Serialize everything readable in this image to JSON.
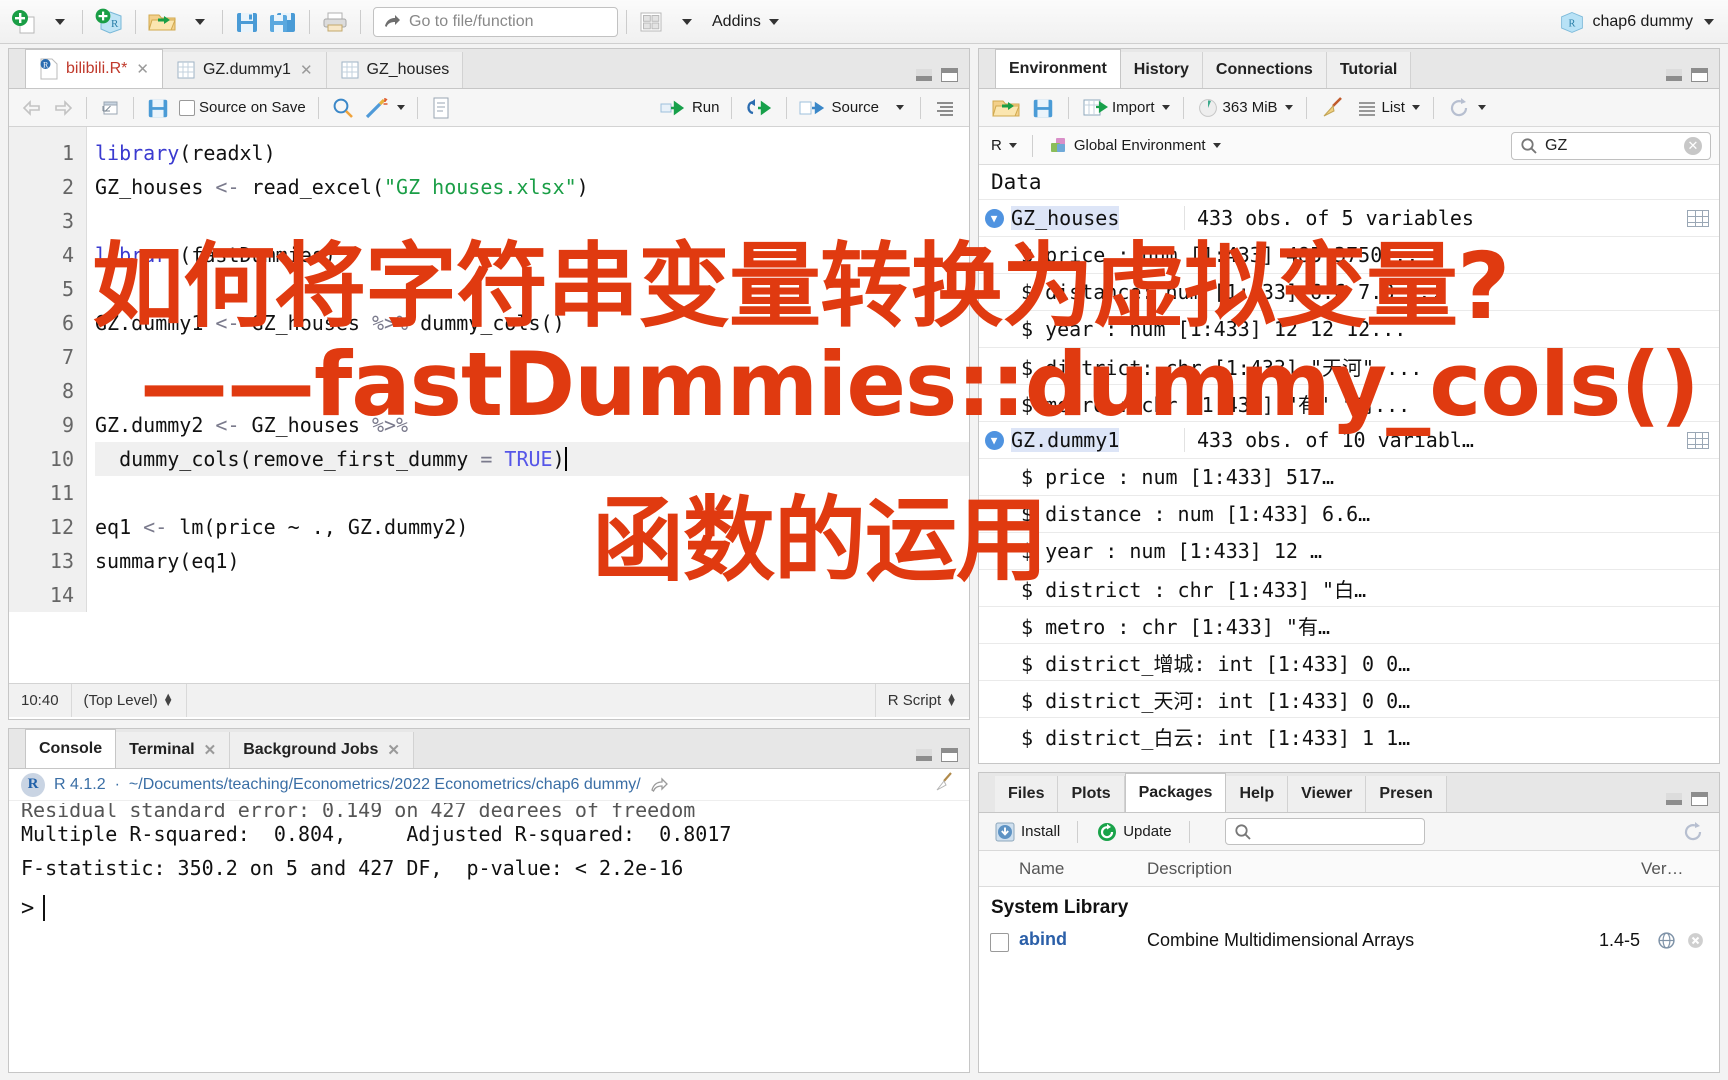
{
  "toolbar": {
    "goto_placeholder": "Go to file/function",
    "addins_label": "Addins",
    "project_name": "chap6 dummy",
    "icons": [
      "new-file-icon",
      "new-project-icon",
      "open-file-icon",
      "save-icon",
      "save-all-icon",
      "print-icon",
      "grid-layout-icon"
    ]
  },
  "source_pane": {
    "tabs": [
      {
        "label": "bilibili.R*",
        "icon": "r-script-icon",
        "closable": true,
        "active": true
      },
      {
        "label": "GZ.dummy1",
        "icon": "data-grid-icon",
        "closable": true,
        "active": false
      },
      {
        "label": "GZ_houses",
        "icon": "data-grid-icon",
        "closable": true,
        "active": false
      }
    ],
    "toolbar": {
      "back_label": "←",
      "forward_label": "→",
      "popout_label": "Show in new window",
      "save_label": "Save",
      "source_on_save_label": "Source on Save",
      "find_label": "Find/Replace",
      "magic_label": "Code Tools",
      "compile_label": "Compile Report",
      "run_label": "Run",
      "rerun_label": "Re-run",
      "source_label": "Source",
      "outline_label": "Document Outline"
    },
    "line_numbers": [
      "1",
      "2",
      "3",
      "4",
      "5",
      "6",
      "7",
      "8",
      "9",
      "10",
      "11",
      "12",
      "13",
      "14"
    ],
    "code": [
      {
        "n": 1,
        "tokens": [
          {
            "t": "library",
            "c": "fn"
          },
          {
            "t": "(readxl)",
            "c": ""
          }
        ]
      },
      {
        "n": 2,
        "tokens": [
          {
            "t": "GZ_houses ",
            "c": ""
          },
          {
            "t": "<-",
            "c": "op"
          },
          {
            "t": " read_excel(",
            "c": ""
          },
          {
            "t": "\"GZ houses.xlsx\"",
            "c": "str"
          },
          {
            "t": ")",
            "c": ""
          }
        ]
      },
      {
        "n": 3,
        "tokens": []
      },
      {
        "n": 4,
        "tokens": [
          {
            "t": "library",
            "c": "fn"
          },
          {
            "t": "(fastDummies)",
            "c": ""
          }
        ]
      },
      {
        "n": 5,
        "tokens": []
      },
      {
        "n": 6,
        "tokens": [
          {
            "t": "GZ.dummy1 ",
            "c": ""
          },
          {
            "t": "<-",
            "c": "op"
          },
          {
            "t": " GZ_houses ",
            "c": ""
          },
          {
            "t": "%>%",
            "c": "op"
          },
          {
            "t": " dummy_cols()",
            "c": ""
          }
        ]
      },
      {
        "n": 7,
        "tokens": []
      },
      {
        "n": 8,
        "tokens": []
      },
      {
        "n": 9,
        "tokens": [
          {
            "t": "GZ.dummy2 ",
            "c": ""
          },
          {
            "t": "<-",
            "c": "op"
          },
          {
            "t": " GZ_houses ",
            "c": ""
          },
          {
            "t": "%>%",
            "c": "op"
          }
        ]
      },
      {
        "n": 10,
        "tokens": [
          {
            "t": "  dummy_cols(remove_first_dummy ",
            "c": ""
          },
          {
            "t": "=",
            "c": "op"
          },
          {
            "t": " ",
            "c": ""
          },
          {
            "t": "TRUE",
            "c": "const"
          },
          {
            "t": ")",
            "c": ""
          }
        ],
        "highlight": true,
        "cursor": true
      },
      {
        "n": 11,
        "tokens": []
      },
      {
        "n": 12,
        "tokens": [
          {
            "t": "eq1 ",
            "c": ""
          },
          {
            "t": "<-",
            "c": "op"
          },
          {
            "t": " lm(price ~ ., GZ.dummy2)",
            "c": ""
          }
        ]
      },
      {
        "n": 13,
        "tokens": [
          {
            "t": "summary(eq1)",
            "c": ""
          }
        ]
      },
      {
        "n": 14,
        "tokens": []
      }
    ],
    "status": {
      "position": "10:40",
      "scope": "(Top Level)",
      "file_type": "R Script"
    }
  },
  "console_pane": {
    "tabs": [
      {
        "label": "Console",
        "closable": false,
        "active": true
      },
      {
        "label": "Terminal",
        "closable": true,
        "active": false
      },
      {
        "label": "Background Jobs",
        "closable": true,
        "active": false
      }
    ],
    "r_version": "R 4.1.2",
    "separator": "·",
    "working_dir": "~/Documents/teaching/Econometrics/2022 Econometrics/chap6 dummy/",
    "output": [
      "Residual standard error: 0.149 on 427 degrees of freedom",
      "Multiple R-squared:  0.804,\tAdjusted R-squared:  0.8017",
      "F-statistic: 350.2 on 5 and 427 DF,  p-value: < 2.2e-16"
    ],
    "prompt": ">"
  },
  "environment_pane": {
    "tabs": [
      {
        "label": "Environment",
        "active": true
      },
      {
        "label": "History",
        "active": false
      },
      {
        "label": "Connections",
        "active": false
      },
      {
        "label": "Tutorial",
        "active": false
      }
    ],
    "toolbar": {
      "load_label": "Load workspace",
      "save_label": "Save workspace",
      "import_label": "Import",
      "memory_label": "363 MiB",
      "broom_label": "Clear objects",
      "view_mode_label": "List",
      "refresh_label": "Refresh"
    },
    "language": "R",
    "scope": "Global Environment",
    "search_value": "GZ",
    "section_label": "Data",
    "objects": [
      {
        "name": "GZ_houses",
        "value": "433 obs. of 5 variables",
        "expanded": true,
        "fields": [
          "$ price   : num [1:433] 485 3750...",
          "$ distance: num [1:433] 6.6 7.8 ...",
          "$ year    : num [1:433] 12 12 12...",
          "$ district: chr [1:433] \"天河\" ...",
          "$ metro   : chr [1:433] \"有\" \"有..."
        ]
      },
      {
        "name": "GZ.dummy1",
        "value": "433 obs. of 10 variabl…",
        "expanded": true,
        "fields": [
          "$ price        : num [1:433] 517…",
          "$ distance     : num [1:433] 6.6…",
          "$ year         : num [1:433] 12 …",
          "$ district     : chr [1:433] \"白…",
          "$ metro        : chr [1:433] \"有…",
          "$ district_增城: int [1:433] 0 0…",
          "$ district_天河: int [1:433] 0 0…",
          "$ district_白云: int [1:433] 1 1…"
        ]
      }
    ]
  },
  "files_pane": {
    "tabs": [
      {
        "label": "Files",
        "active": false
      },
      {
        "label": "Plots",
        "active": false
      },
      {
        "label": "Packages",
        "active": true
      },
      {
        "label": "Help",
        "active": false
      },
      {
        "label": "Viewer",
        "active": false
      },
      {
        "label": "Presen",
        "active": false
      }
    ],
    "toolbar": {
      "install_label": "Install",
      "update_label": "Update",
      "search_placeholder": ""
    },
    "columns": [
      "",
      "Name",
      "Description",
      "Ver…"
    ],
    "library_label": "System Library",
    "packages": [
      {
        "name": "abind",
        "description": "Combine Multidimensional Arrays",
        "version": "1.4-5",
        "checked": false
      }
    ]
  },
  "annotation": {
    "line1": "如何将字符串变量转换为虚拟变量?",
    "line2": "——fastDummies::dummy_cols()",
    "line3": "函数的运用",
    "color": "#e03a10"
  }
}
